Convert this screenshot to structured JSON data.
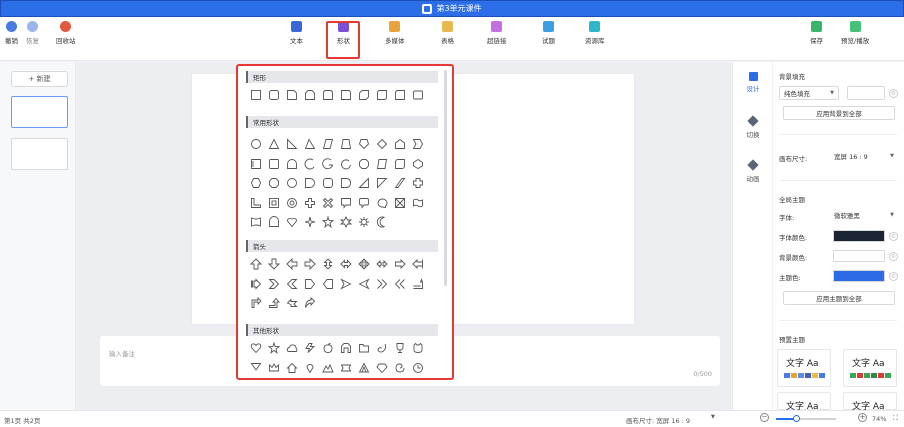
{
  "title": "第3单元课件",
  "toolbar": {
    "undo": "撤销",
    "redo": "恢复",
    "recycle": "回收站",
    "text": "文本",
    "shape": "形状",
    "media": "多媒体",
    "table": "表格",
    "hyperlink": "超链接",
    "quiz": "试题",
    "library": "资源库",
    "save": "保存",
    "preview": "预览/播放"
  },
  "left": {
    "new_label": "+ 新建"
  },
  "notes": {
    "placeholder": "输入备注",
    "count": "0/500"
  },
  "right_tabs": {
    "design": "设计",
    "transition": "切换",
    "animation": "动画"
  },
  "props": {
    "bg_fill_title": "背景填充",
    "fill_type": "纯色填充",
    "apply_bg": "应用背景到全部",
    "canvas_size_label": "画布尺寸:",
    "canvas_size_value": "宽屏 16 : 9",
    "global_theme": "全局主题",
    "font_label": "字体:",
    "font_value": "微软雅黑",
    "font_color_label": "字体颜色:",
    "bg_color_label": "背景颜色:",
    "theme_color_label": "主题色:",
    "apply_theme": "应用主题到全部",
    "preset_title": "预置主题",
    "preset_sample": "文字 Aa",
    "colors": {
      "font": "#1b2433",
      "bg": "#ffffff",
      "theme": "#2d6be6"
    },
    "palettes": [
      [
        "#4a7be0",
        "#e4a33b",
        "#5b8ee6",
        "#3f5fbf",
        "#e8b94c",
        "#4a7be0"
      ],
      [
        "#3aa655",
        "#d93a3a",
        "#3aa655",
        "#2b8a44",
        "#d93a3a",
        "#3aa655"
      ]
    ]
  },
  "shapes_panel": {
    "sections": {
      "rect": "矩形",
      "common": "常用形状",
      "arrow": "箭头",
      "other": "其他形状"
    }
  },
  "status": {
    "page": "第1页  共2页",
    "canvas_size": "画布尺寸:  宽屏 16 : 9",
    "zoom": "74%"
  }
}
